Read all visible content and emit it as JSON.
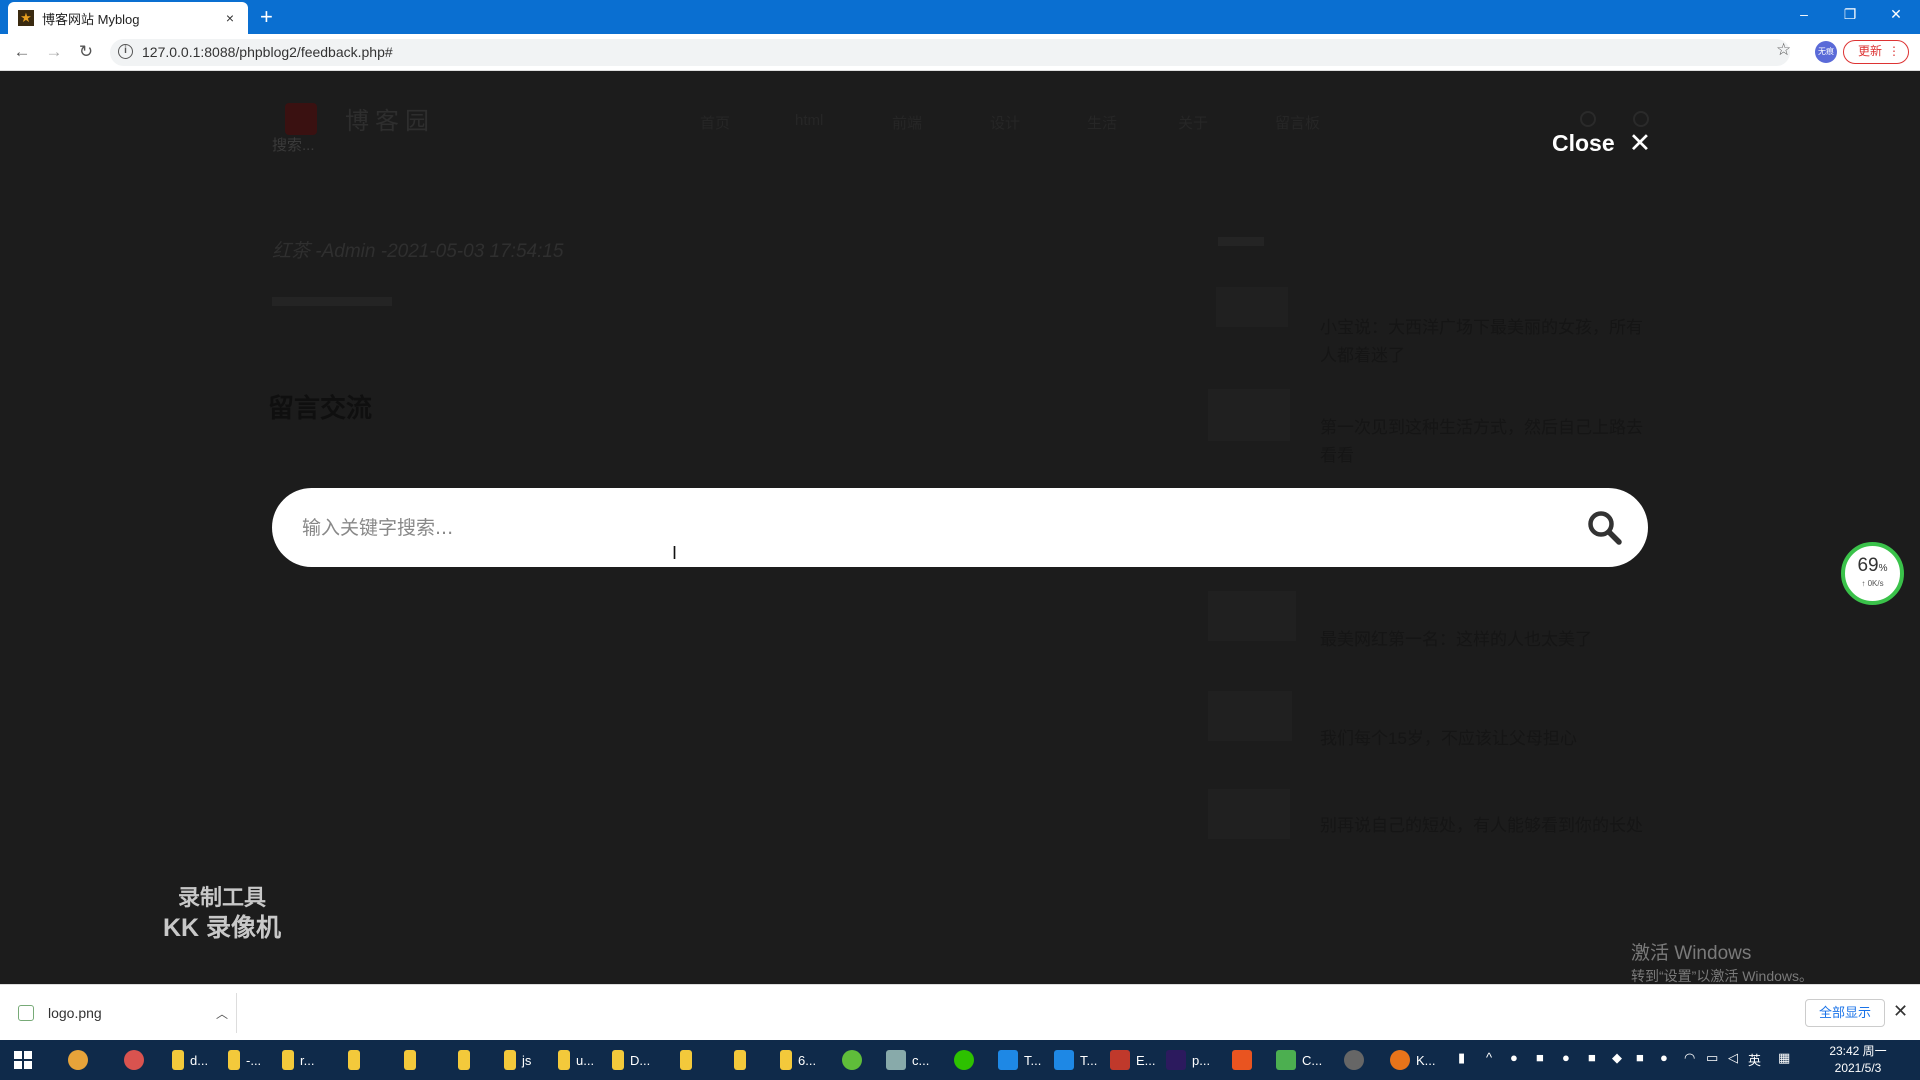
{
  "browser": {
    "tab_title": "博客网站 Myblog",
    "tab_close": "×",
    "new_tab": "+",
    "url": "127.0.0.1:8088/phpblog2/feedback.php#",
    "update_label": "更新",
    "profile_label": "无痕"
  },
  "window_controls": [
    "–",
    "❐",
    "✕"
  ],
  "page_bg": {
    "logo_text": "博客园",
    "search_label": "搜索...",
    "nav": [
      "首页",
      "html",
      "前端",
      "设计",
      "生活",
      "关于",
      "留言板"
    ],
    "author_line": "红茶 -Admin  -2021-05-03 17:54:15",
    "heading": "留言交流",
    "side_posts": [
      "小宝说：大西洋广场下最美丽的女孩，所有人都着迷了",
      "第一次见到这种生活方式，然后自己上路去看看",
      "最美网红第一名：这样的人也太美了",
      "我们每个15岁，不应该让父母担心",
      "别再说自己的短处，有人能够看到你的长处"
    ]
  },
  "overlay": {
    "close_label": "Close",
    "close_icon": "✕",
    "search_placeholder": "输入关键字搜索...",
    "search_value": ""
  },
  "net_meter": {
    "percent": "69",
    "unit": "%",
    "speed": "↑ 0K/s"
  },
  "watermark": {
    "line1": "录制工具",
    "line2": "KK 录像机"
  },
  "activation": {
    "title": "激活 Windows",
    "subtitle": "转到“设置”以激活 Windows。"
  },
  "download_bar": {
    "filename": "logo.png",
    "show_all": "全部显示",
    "close": "✕"
  },
  "taskbar": {
    "items": [
      "d...",
      "-...",
      "r...",
      "",
      "",
      "",
      "js",
      "u...",
      "D...",
      "",
      "6...",
      "",
      "c...",
      "",
      "T...",
      "T...",
      "E...",
      "p...",
      "",
      "C...",
      "",
      "K..."
    ],
    "ime": "英",
    "time": "23:42 周一",
    "date": "2021/5/3"
  },
  "colors": {
    "chrome_blue": "#0a6fd1",
    "overlay_bg": "#1c1c1c",
    "meter_green": "#3ac24a",
    "update_red": "#dd3333"
  }
}
